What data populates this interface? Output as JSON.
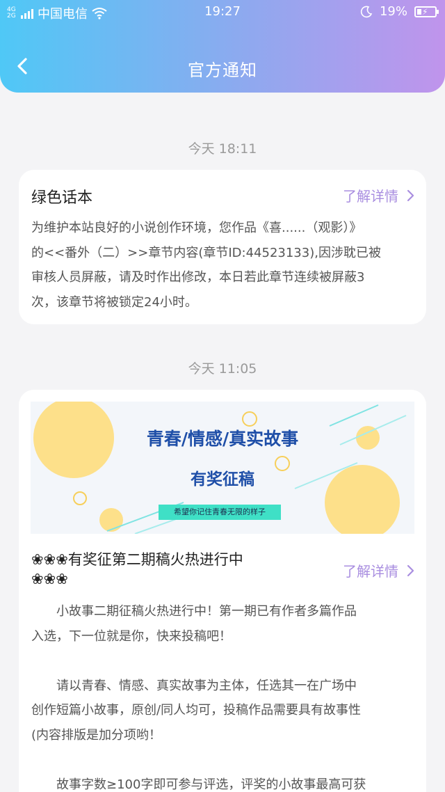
{
  "status_bar": {
    "network_top": "4G",
    "network_bottom": "2G",
    "carrier": "中国电信",
    "time": "19:27",
    "battery": "19%"
  },
  "header": {
    "title": "官方通知"
  },
  "notifications": [
    {
      "timestamp": "今天 18:11",
      "title": "绿色话本",
      "more_label": "了解详情",
      "lines": [
        "为维护本站良好的小说创作环境，您作品《喜......（观影）》",
        "的<<番外（二）>>章节内容(章节ID:44523133),因涉耽已被",
        "审核人员屏蔽，请及时作出修改，本日若此章节连续被屏蔽3",
        "次，该章节将被锁定24小时。"
      ]
    },
    {
      "timestamp": "今天 11:05",
      "banner": {
        "headline": "青春/情感/真实故事",
        "subheadline": "有奖征稿",
        "tagline": "希望你记住青春无限的样子"
      },
      "title_line1": "❀❀❀有奖征第二期稿火热进行中",
      "title_line2": "❀❀❀",
      "more_label": "了解详情",
      "lines": [
        "　　小故事二期征稿火热进行中！第一期已有作者多篇作品",
        "入选，下一位就是你，快来投稿吧！",
        "",
        "　　请以青春、情感、真实故事为主体，任选其一在广场中",
        "创作短篇小故事，原创/同人均可，投稿作品需要具有故事性",
        "(内容排版是加分项哟！",
        "",
        "　　故事字数≥100字即可参与评选，评奖的小故事最高可获"
      ]
    }
  ],
  "colors": {
    "accent": "#a98ee0",
    "header_gradient_start": "#4fc8f6",
    "header_gradient_end": "#c094ec",
    "background": "#f4f4f6"
  }
}
